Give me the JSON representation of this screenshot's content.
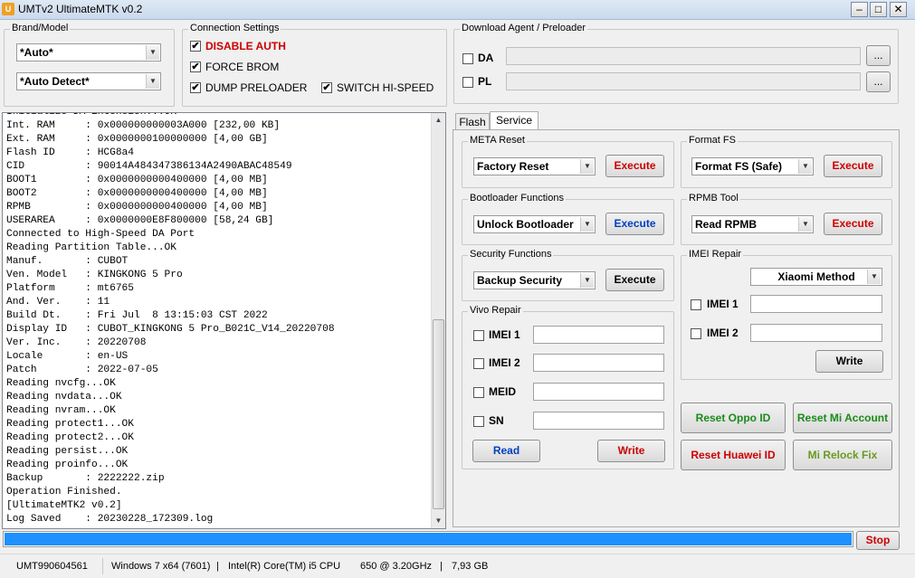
{
  "window": {
    "title": "UMTv2 UltimateMTK v0.2",
    "icon_label": "U",
    "minimize": "–",
    "maximize": "□",
    "close": "✕"
  },
  "brand_model": {
    "title": "Brand/Model",
    "brand": "*Auto*",
    "model": "*Auto Detect*"
  },
  "connection": {
    "title": "Connection Settings",
    "disable_auth": "DISABLE AUTH",
    "force_brom": "FORCE BROM",
    "dump_preloader": "DUMP PRELOADER",
    "switch_hispeed": "SWITCH HI-SPEED",
    "check": "✔"
  },
  "download_agent": {
    "title": "Download Agent / Preloader",
    "da_label": "DA",
    "pl_label": "PL",
    "browse": "..."
  },
  "log": {
    "lines": [
      "Initialize DA Extension...OK",
      "Int. RAM     : 0x000000000003A000 [232,00 KB]",
      "Ext. RAM     : 0x0000000100000000 [4,00 GB]",
      "Flash ID     : HCG8a4",
      "CID          : 90014A484347386134A2490ABAC48549",
      "BOOT1        : 0x0000000000400000 [4,00 MB]",
      "BOOT2        : 0x0000000000400000 [4,00 MB]",
      "RPMB         : 0x0000000000400000 [4,00 MB]",
      "USERAREA     : 0x0000000E8F800000 [58,24 GB]",
      "Connected to High-Speed DA Port",
      "Reading Partition Table...OK",
      "Manuf.       : CUBOT",
      "Ven. Model   : KINGKONG 5 Pro",
      "Platform     : mt6765",
      "And. Ver.    : 11",
      "Build Dt.    : Fri Jul  8 13:15:03 CST 2022",
      "Display ID   : CUBOT_KINGKONG 5 Pro_B021C_V14_20220708",
      "Ver. Inc.    : 20220708",
      "Locale       : en-US",
      "Patch        : 2022-07-05",
      "Reading nvcfg...OK",
      "Reading nvdata...OK",
      "Reading nvram...OK",
      "Reading protect1...OK",
      "Reading protect2...OK",
      "Reading persist...OK",
      "Reading proinfo...OK",
      "Backup       : 2222222.zip",
      "Operation Finished.",
      "[UltimateMTK2 v0.2]",
      "Log Saved    : 20230228_172309.log"
    ]
  },
  "tabs": {
    "flash": "Flash",
    "service": "Service"
  },
  "meta_reset": {
    "title": "META Reset",
    "selected": "Factory Reset",
    "execute": "Execute"
  },
  "format_fs": {
    "title": "Format FS",
    "selected": "Format FS (Safe)",
    "execute": "Execute"
  },
  "bootloader": {
    "title": "Bootloader Functions",
    "selected": "Unlock Bootloader",
    "execute": "Execute"
  },
  "rpmb": {
    "title": "RPMB Tool",
    "selected": "Read RPMB",
    "execute": "Execute"
  },
  "security": {
    "title": "Security Functions",
    "selected": "Backup Security",
    "execute": "Execute"
  },
  "imei_repair": {
    "title": "IMEI Repair",
    "method": "Xiaomi Method",
    "imei1": "IMEI 1",
    "imei2": "IMEI 2",
    "write": "Write"
  },
  "vivo_repair": {
    "title": "Vivo Repair",
    "imei1": "IMEI 1",
    "imei2": "IMEI 2",
    "meid": "MEID",
    "sn": "SN",
    "read": "Read",
    "write": "Write"
  },
  "actions": {
    "reset_oppo": "Reset Oppo ID",
    "reset_mi": "Reset Mi Account",
    "reset_huawei": "Reset Huawei ID",
    "mi_relock": "Mi Relock Fix"
  },
  "progress": {
    "value": 1.0,
    "stop": "Stop"
  },
  "status": {
    "device_id": "UMT990604561",
    "os": "Windows 7 x64 (7601)",
    "cpu": "Intel(R) Core(TM) i5 CPU",
    "freq": "650  @ 3.20GHz",
    "ram": "7,93 GB"
  },
  "colors": {
    "accent_red": "#cc0000",
    "accent_blue": "#0040c0",
    "accent_green": "#1a8c1a",
    "progress_fill": "#1e90ff"
  }
}
